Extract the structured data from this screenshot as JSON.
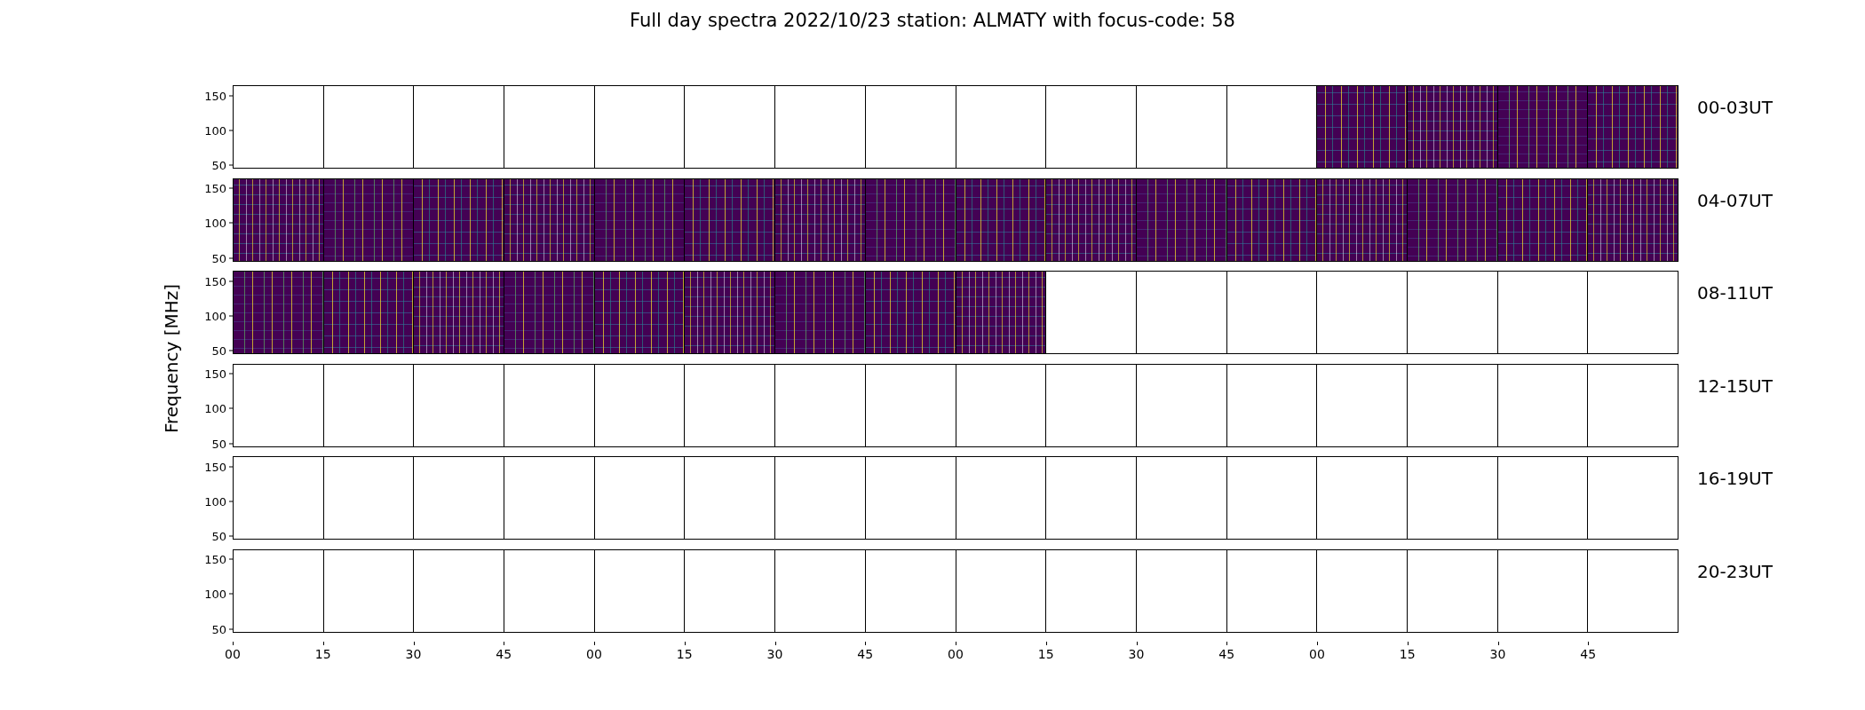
{
  "title": "Full day spectra 2022/10/23 station: ALMATY with focus-code: 58",
  "ylabel": "Frequency [MHz]",
  "rows": [
    {
      "label": "00-03UT",
      "yticks": [
        "150",
        "100",
        "50"
      ],
      "panels": [
        false,
        false,
        false,
        false,
        false,
        false,
        false,
        false,
        false,
        false,
        false,
        false,
        true,
        true,
        true,
        true
      ]
    },
    {
      "label": "04-07UT",
      "yticks": [
        "150",
        "100",
        "50"
      ],
      "panels": [
        true,
        true,
        true,
        true,
        true,
        true,
        true,
        true,
        true,
        true,
        true,
        true,
        true,
        true,
        true,
        true
      ]
    },
    {
      "label": "08-11UT",
      "yticks": [
        "150",
        "100",
        "50"
      ],
      "panels": [
        true,
        true,
        true,
        true,
        true,
        true,
        true,
        true,
        true,
        false,
        false,
        false,
        false,
        false,
        false,
        false
      ]
    },
    {
      "label": "12-15UT",
      "yticks": [
        "150",
        "100",
        "50"
      ],
      "panels": [
        false,
        false,
        false,
        false,
        false,
        false,
        false,
        false,
        false,
        false,
        false,
        false,
        false,
        false,
        false,
        false
      ]
    },
    {
      "label": "16-19UT",
      "yticks": [
        "150",
        "100",
        "50"
      ],
      "panels": [
        false,
        false,
        false,
        false,
        false,
        false,
        false,
        false,
        false,
        false,
        false,
        false,
        false,
        false,
        false,
        false
      ]
    },
    {
      "label": "20-23UT",
      "yticks": [
        "150",
        "100",
        "50"
      ],
      "panels": [
        false,
        false,
        false,
        false,
        false,
        false,
        false,
        false,
        false,
        false,
        false,
        false,
        false,
        false,
        false,
        false
      ]
    }
  ],
  "xticks": [
    "00",
    "15",
    "30",
    "45",
    "00",
    "15",
    "30",
    "45",
    "00",
    "15",
    "30",
    "45",
    "00",
    "15",
    "30",
    "45"
  ]
}
